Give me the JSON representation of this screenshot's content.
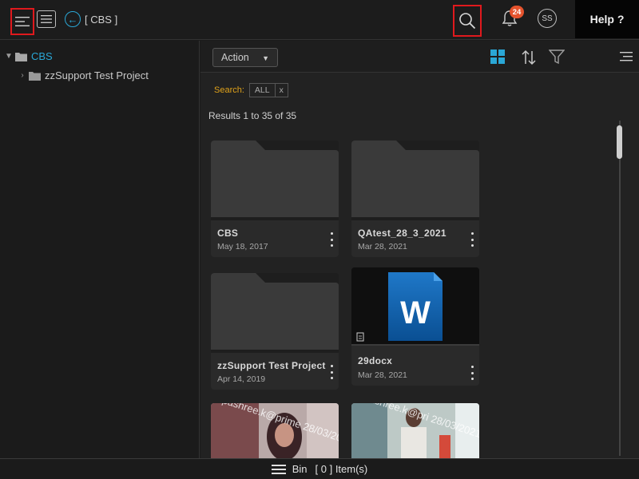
{
  "header": {
    "breadcrumb": "[ CBS ]",
    "notification_count": "24",
    "avatar_initials": "SS",
    "help_label": "Help ?"
  },
  "sidebar": {
    "root": {
      "label": "CBS",
      "icon": "folder-icon"
    },
    "items": [
      {
        "label": "zzSupport Test Project",
        "icon": "folder-icon"
      }
    ]
  },
  "toolbar": {
    "action_label": "Action",
    "icons": [
      "grid-view-icon",
      "sort-icon",
      "filter-icon",
      "list-menu-icon"
    ]
  },
  "search": {
    "label": "Search:",
    "chip": "ALL",
    "clear": "x"
  },
  "results_text": "Results 1 to 35 of 35",
  "cards": [
    {
      "name": "CBS",
      "date": "May 18, 2017",
      "type": "folder"
    },
    {
      "name": "QAtest_28_3_2021",
      "date": "Mar 28, 2021",
      "type": "folder"
    },
    {
      "name": "zzSupport Test Project",
      "date": "Apr 14, 2019",
      "type": "folder"
    },
    {
      "name": "29docx",
      "date": "Mar 28, 2021",
      "type": "word-document",
      "doc_letter": "W"
    },
    {
      "type": "video-thumbnail",
      "watermark": "lipashree.k@prime 28/03/2021 1"
    },
    {
      "type": "video-thumbnail",
      "watermark": "lipashree.k@pri 28/03/2021"
    }
  ],
  "bottom": {
    "label": "Bin",
    "count": "[ 0 ] Item(s)"
  },
  "colors": {
    "accent": "#2aa7d6",
    "highlight": "#e0191d",
    "badge": "#e5532d",
    "search_label": "#e0a21a"
  }
}
